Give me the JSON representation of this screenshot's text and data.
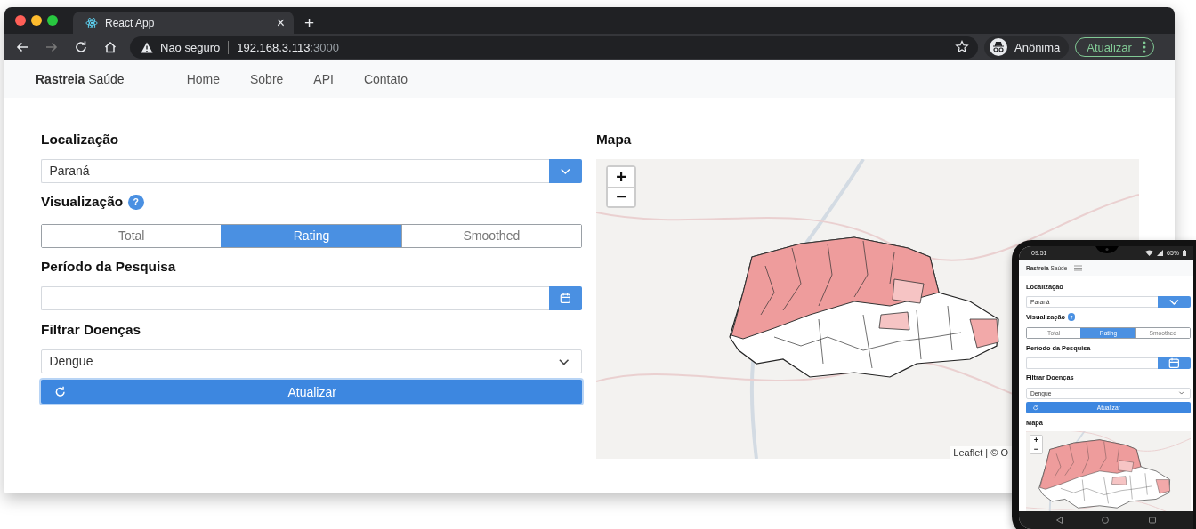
{
  "browser": {
    "tab": {
      "title": "React App",
      "close": "×"
    },
    "new_tab": "+",
    "address": {
      "security": "Não seguro",
      "host": "192.168.3.113",
      "port": ":3000"
    },
    "profile": "Anônima",
    "update_button": "Atualizar"
  },
  "navbar": {
    "brand": "**Rastreia** Saúde",
    "links": [
      {
        "label": "Home"
      },
      {
        "label": "Sobre"
      },
      {
        "label": "API"
      },
      {
        "label": "Contato"
      }
    ]
  },
  "form": {
    "location": {
      "label": "Localização",
      "value": "Paraná"
    },
    "visualization": {
      "label": "Visualização",
      "help": "?",
      "options": [
        {
          "label": "Total",
          "selected": false
        },
        {
          "label": "Rating",
          "selected": true
        },
        {
          "label": "Smoothed",
          "selected": false
        }
      ]
    },
    "period": {
      "label": "Período da Pesquisa"
    },
    "disease": {
      "label": "Filtrar Doenças",
      "value": "Dengue"
    },
    "submit": "Atualizar"
  },
  "map": {
    "title": "Mapa",
    "zoom_in": "+",
    "zoom_out": "−",
    "attribution": "Leaflet | © O"
  },
  "phone": {
    "time": "09:51",
    "battery": "65%",
    "brand": "**Rastreia** Saúde",
    "form": {
      "location": {
        "label": "Localização",
        "value": "Paraná"
      },
      "visualization": {
        "label": "Visualização",
        "help": "?",
        "options": [
          {
            "label": "Total",
            "selected": false
          },
          {
            "label": "Rating",
            "selected": true
          },
          {
            "label": "Smoothed",
            "selected": false
          }
        ]
      },
      "period": {
        "label": "Período da Pesquisa"
      },
      "disease": {
        "label": "Filtrar Doenças",
        "value": "Dengue"
      },
      "submit": "Atualizar"
    },
    "map": {
      "title": "Mapa",
      "zoom_in": "+",
      "zoom_out": "−"
    }
  }
}
